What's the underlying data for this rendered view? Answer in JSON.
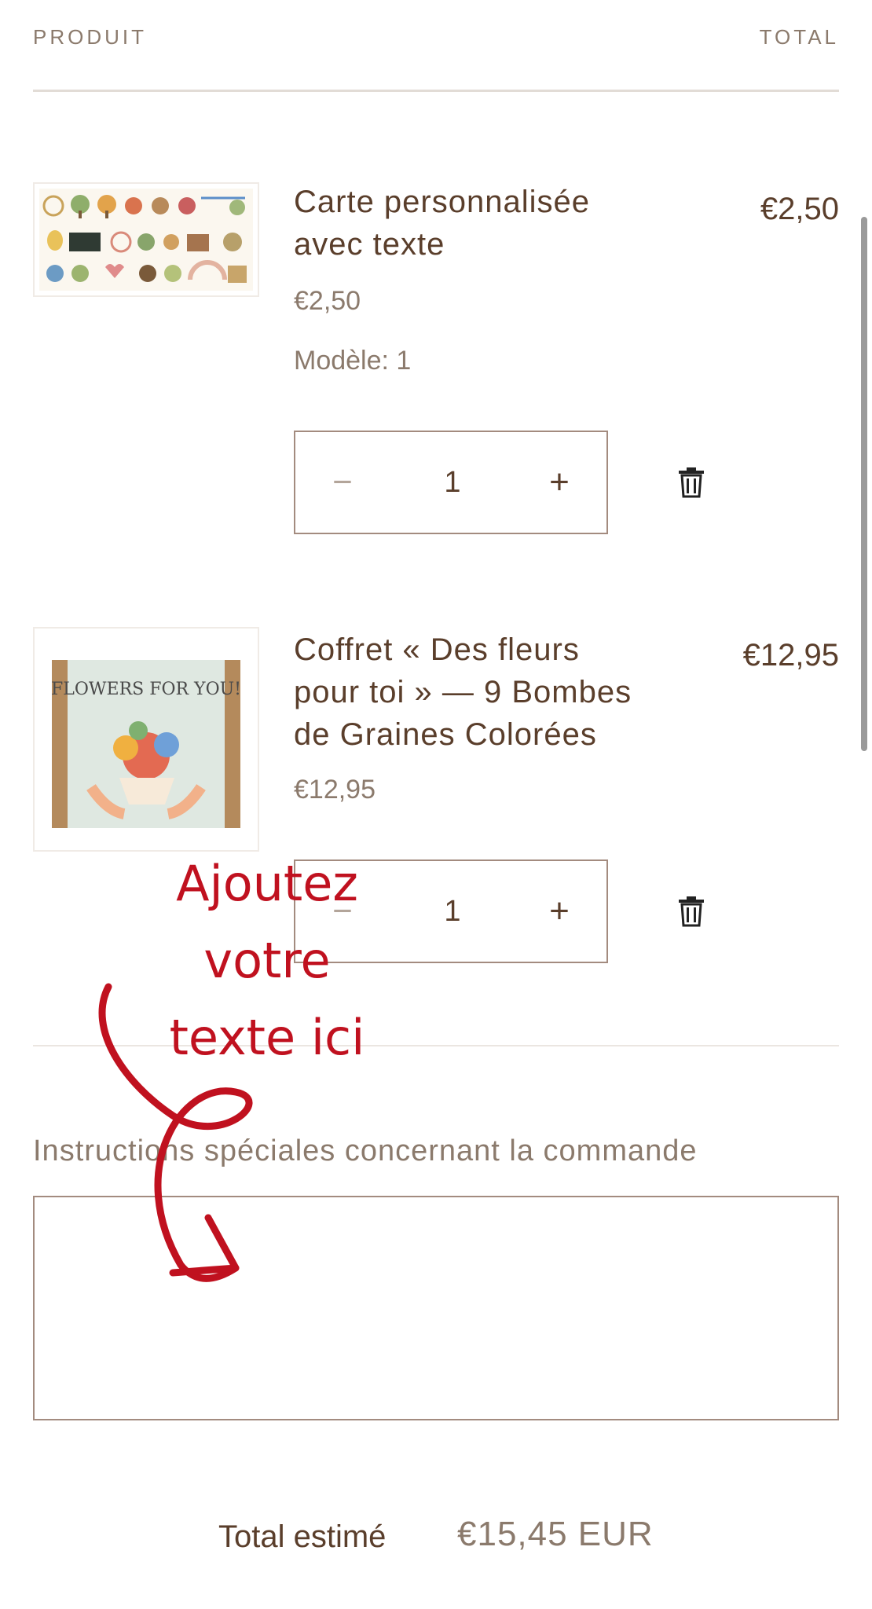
{
  "header": {
    "product_label": "PRODUIT",
    "total_label": "TOTAL"
  },
  "items": [
    {
      "title_line1": "Carte personnalisée",
      "title_line2": "avec texte",
      "title_line3": "",
      "price": "€2,50",
      "unit_price": "€2,50",
      "variant": "Modèle: 1",
      "quantity": "1",
      "image": "card-illustrations-thumbnail"
    },
    {
      "title_line1": "Coffret « Des fleurs",
      "title_line2": "pour toi » — 9 Bombes",
      "title_line3": "de Graines Colorées",
      "price": "€12,95",
      "unit_price": "€12,95",
      "variant": "",
      "quantity": "1",
      "image": "flowers-box-thumbnail",
      "image_text": "FLOWERS FOR YOU!"
    }
  ],
  "qty_controls": {
    "minus": "−",
    "plus": "+"
  },
  "overlay": {
    "line1": "Ajoutez",
    "line2": "votre",
    "line3": "texte ici",
    "color": "#c0111f"
  },
  "instructions": {
    "label": "Instructions spéciales concernant la commande",
    "value": ""
  },
  "summary": {
    "label": "Total estimé",
    "value": "€15,45 EUR"
  },
  "colors": {
    "text": "#5a3e2b",
    "muted": "#8b7a6c",
    "border": "#a38b7f",
    "accent": "#c0111f"
  }
}
